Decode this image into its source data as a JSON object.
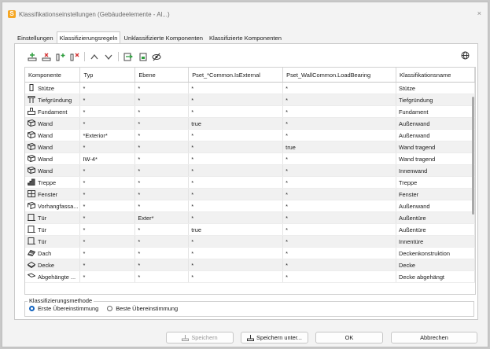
{
  "window": {
    "title": "Klassifikationseinstellungen (Gebäudeelemente - Al...)",
    "close_glyph": "×",
    "app_letter": "S"
  },
  "tabs": [
    {
      "label": "Einstellungen",
      "active": false
    },
    {
      "label": "Klassifizierungsregeln",
      "active": true
    },
    {
      "label": "Unklassifizierte Komponenten",
      "active": false
    },
    {
      "label": "Klassifizierte Komponenten",
      "active": false
    }
  ],
  "toolbar": {
    "buttons": [
      "add-row-icon",
      "remove-row-icon",
      "add-column-icon",
      "remove-column-icon",
      "move-up-icon",
      "move-down-icon",
      "import-icon",
      "export-icon",
      "visibility-icon"
    ],
    "globe": "globe-icon"
  },
  "table": {
    "headers": [
      "Komponente",
      "Typ",
      "Ebene",
      "Pset_*Common.IsExternal",
      "Pset_WallCommon.LoadBearing",
      "Klassifikationsname"
    ],
    "rows": [
      {
        "icon": "column-icon",
        "cells": [
          "Stütze",
          "*",
          "*",
          "*",
          "*",
          "Stütze"
        ]
      },
      {
        "icon": "deep-foundation-icon",
        "cells": [
          "Tiefgründung",
          "*",
          "*",
          "*",
          "*",
          "Tiefgründung"
        ]
      },
      {
        "icon": "footing-icon",
        "cells": [
          "Fundament",
          "*",
          "*",
          "*",
          "*",
          "Fundament"
        ]
      },
      {
        "icon": "wall-icon",
        "cells": [
          "Wand",
          "*",
          "*",
          "true",
          "*",
          "Außenwand"
        ]
      },
      {
        "icon": "wall-icon",
        "cells": [
          "Wand",
          "*Exterior*",
          "*",
          "*",
          "*",
          "Außenwand"
        ]
      },
      {
        "icon": "wall-icon",
        "cells": [
          "Wand",
          "*",
          "*",
          "*",
          "true",
          "Wand tragend"
        ]
      },
      {
        "icon": "wall-icon",
        "cells": [
          "Wand",
          "IW-4*",
          "*",
          "*",
          "*",
          "Wand tragend"
        ]
      },
      {
        "icon": "wall-icon",
        "cells": [
          "Wand",
          "*",
          "*",
          "*",
          "*",
          "Innenwand"
        ]
      },
      {
        "icon": "stair-icon",
        "cells": [
          "Treppe",
          "*",
          "*",
          "*",
          "*",
          "Treppe"
        ]
      },
      {
        "icon": "window-icon",
        "cells": [
          "Fenster",
          "*",
          "*",
          "*",
          "*",
          "Fenster"
        ]
      },
      {
        "icon": "curtain-wall-icon",
        "cells": [
          "Vorhangfassa...",
          "*",
          "*",
          "*",
          "*",
          "Außenwand"
        ]
      },
      {
        "icon": "door-icon",
        "cells": [
          "Tür",
          "*",
          "Exter*",
          "*",
          "*",
          "Außentüre"
        ]
      },
      {
        "icon": "door-icon",
        "cells": [
          "Tür",
          "*",
          "*",
          "true",
          "*",
          "Außentüre"
        ]
      },
      {
        "icon": "door-icon",
        "cells": [
          "Tür",
          "*",
          "*",
          "*",
          "*",
          "Innentüre"
        ]
      },
      {
        "icon": "roof-icon",
        "cells": [
          "Dach",
          "*",
          "*",
          "*",
          "*",
          "Deckenkonstruktion"
        ]
      },
      {
        "icon": "slab-icon",
        "cells": [
          "Decke",
          "*",
          "*",
          "*",
          "*",
          "Decke"
        ]
      },
      {
        "icon": "suspended-ceiling-icon",
        "cells": [
          "Abgehängte ...",
          "*",
          "*",
          "*",
          "*",
          "Decke abgehängt"
        ]
      }
    ]
  },
  "method": {
    "legend": "Klassifizierungsmethode",
    "options": [
      {
        "label": "Erste Übereinstimmung",
        "selected": true
      },
      {
        "label": "Beste Übereinstimmung",
        "selected": false
      }
    ]
  },
  "footer": {
    "save": "Speichern",
    "save_as": "Speichern unter...",
    "ok": "OK",
    "cancel": "Abbrechen"
  },
  "colors": {
    "accent": "#1565c0",
    "app_icon": "#f5a623",
    "add_green": "#2e9e3e",
    "remove_red": "#d32f2f"
  }
}
